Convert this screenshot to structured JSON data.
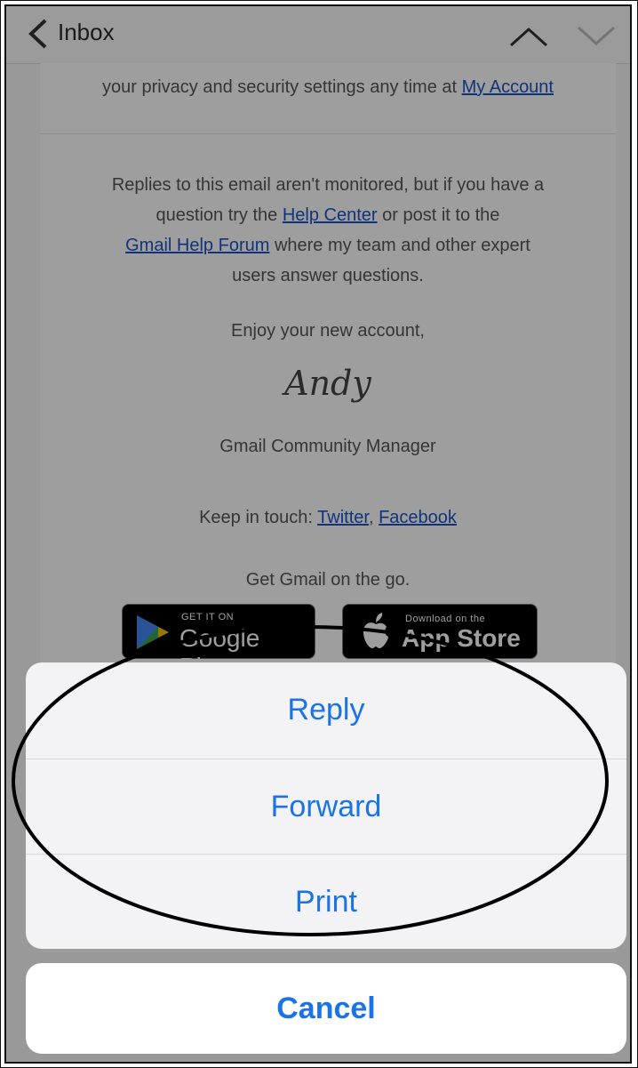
{
  "navbar": {
    "title": "Inbox",
    "back_icon": "chevron-left-icon",
    "prev_icon": "chevron-up-icon",
    "next_icon": "chevron-down-icon"
  },
  "email": {
    "privacy_text": "your privacy and security settings any time at ",
    "privacy_link": "My Account",
    "replies_line1": "Replies to this email aren't monitored, but if you have a",
    "replies_line2_a": "question try the ",
    "replies_help_center": "Help Center",
    "replies_line2_b": " or post it to the",
    "replies_forum": "Gmail Help Forum",
    "replies_line3_b": " where my team and other expert",
    "replies_line4": "users answer questions.",
    "enjoy": "Enjoy your new account,",
    "signature": "Andy",
    "role": "Gmail Community Manager",
    "keep_in_touch": "Keep in touch: ",
    "twitter": "Twitter",
    "comma": ", ",
    "facebook": "Facebook",
    "get_gmail": "Get Gmail on the go."
  },
  "badges": {
    "google_play_small": "GET IT ON",
    "google_play_big": "Google Play",
    "app_store_small": "Download on the",
    "app_store_big": "App Store"
  },
  "action_sheet": {
    "reply": "Reply",
    "forward": "Forward",
    "print": "Print",
    "cancel": "Cancel"
  },
  "colors": {
    "action_text": "#1a73e8",
    "link": "#1c53c6"
  }
}
